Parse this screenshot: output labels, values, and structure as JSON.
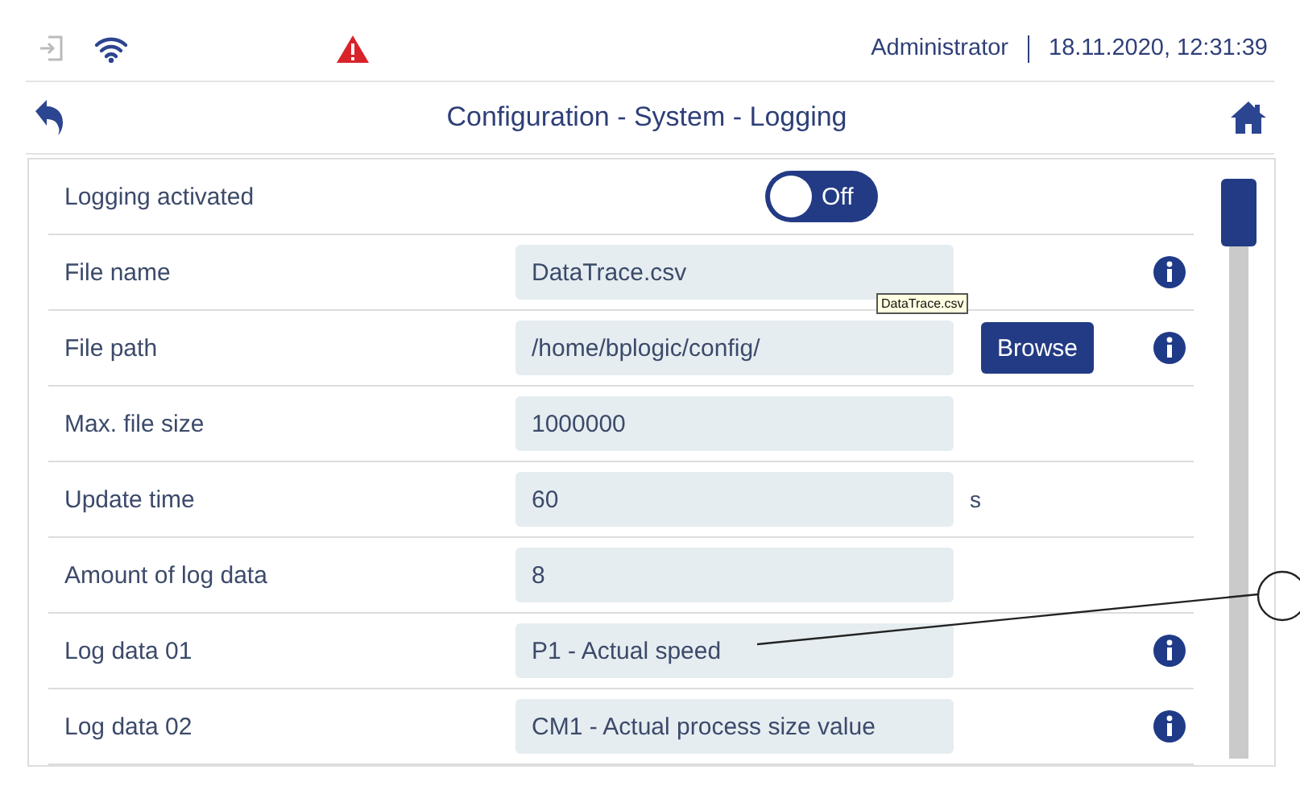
{
  "status_bar": {
    "warning": true,
    "user": "Administrator",
    "datetime": "18.11.2020, 12:31:39"
  },
  "header": {
    "title": "Configuration - System - Logging"
  },
  "rows": [
    {
      "kind": "toggle",
      "label": "Logging activated",
      "on": false,
      "toggle_label": "Off"
    },
    {
      "kind": "field",
      "label": "File name",
      "value": "DataTrace.csv",
      "info": true,
      "tooltip": "DataTrace.csv"
    },
    {
      "kind": "field",
      "label": "File path",
      "value": "/home/bplogic/config/",
      "info": true,
      "button": "Browse"
    },
    {
      "kind": "field",
      "label": "Max. file size",
      "value": "1000000",
      "info": false
    },
    {
      "kind": "field",
      "label": "Update time",
      "value": "60",
      "info": false,
      "unit": "s"
    },
    {
      "kind": "field",
      "label": "Amount of log data",
      "value": "8",
      "info": false
    },
    {
      "kind": "field",
      "label": "Log data 01",
      "value": "P1 - Actual speed",
      "info": true
    },
    {
      "kind": "field",
      "label": "Log data 02",
      "value": "CM1 - Actual process size value",
      "info": true
    }
  ]
}
